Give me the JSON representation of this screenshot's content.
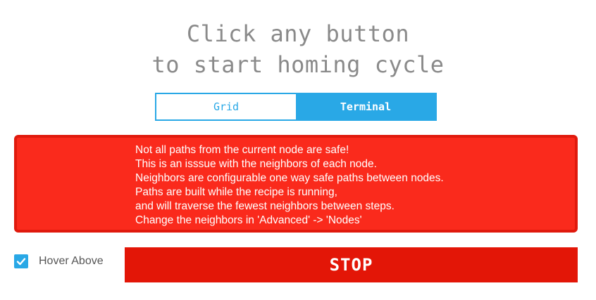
{
  "header": {
    "title_line1": "Click any button",
    "title_line2": "to start homing cycle"
  },
  "tabs": [
    {
      "label": "Grid",
      "active": false
    },
    {
      "label": "Terminal",
      "active": true
    }
  ],
  "warning": {
    "lines": [
      "Not all paths from the current node are safe!",
      "This is an isssue with the neighbors of each node.",
      "Neighbors are configurable one way safe paths between nodes.",
      "Paths are built while the recipe is running,",
      "and will traverse the fewest neighbors between steps.",
      "Change the neighbors in 'Advanced' -> 'Nodes'"
    ]
  },
  "hover_above": {
    "label": "Hover Above",
    "checked": true
  },
  "stop_button": {
    "label": "STOP"
  },
  "colors": {
    "accent": "#29a8e6",
    "warning_bg": "#fa2a1c",
    "stop_bg": "#e31607",
    "title_text": "#8a8a8a"
  },
  "icons": {
    "checkbox": "check-icon"
  }
}
